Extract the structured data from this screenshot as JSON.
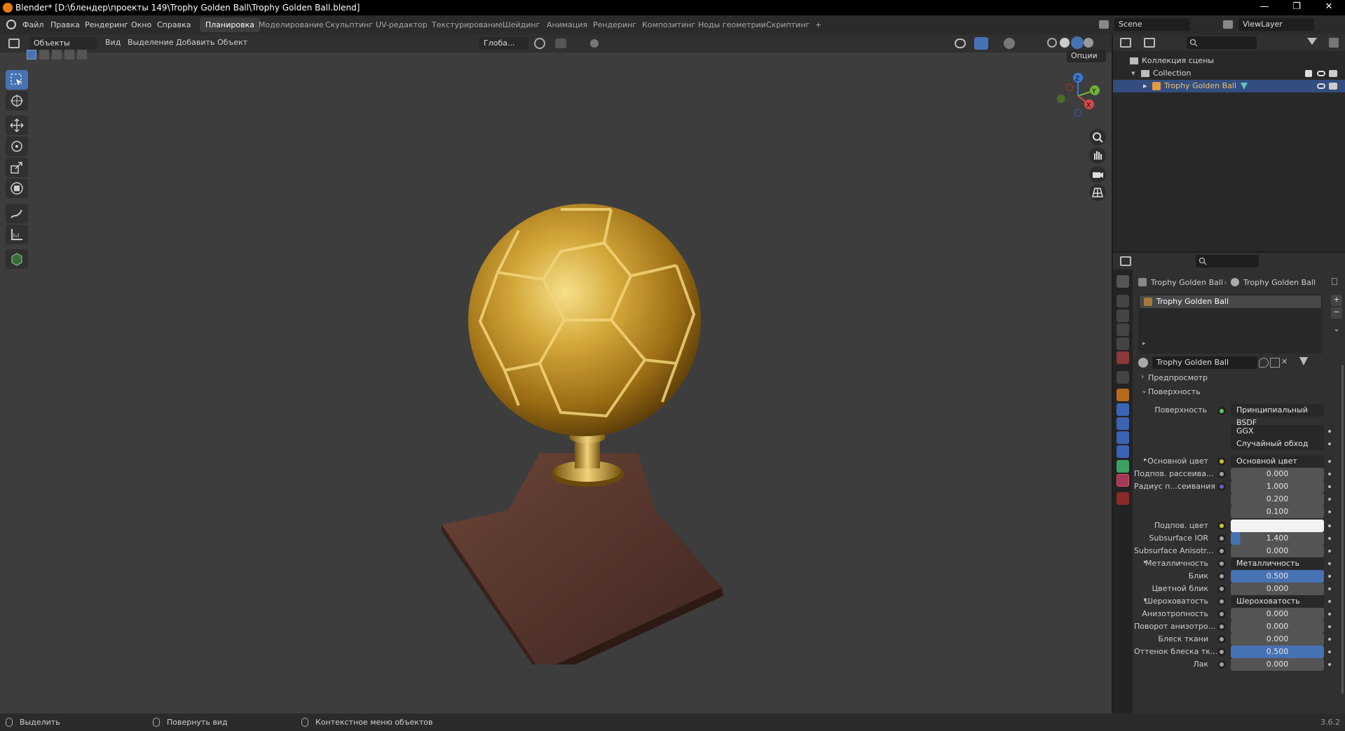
{
  "window": {
    "title": "Blender* [D:\\блендер\\проекты 149\\Trophy Golden Ball\\Trophy Golden Ball.blend]",
    "minimize": "—",
    "maximize": "❐",
    "close": "✕"
  },
  "menu": [
    "Файл",
    "Правка",
    "Рендеринг",
    "Окно",
    "Справка"
  ],
  "workspaces": [
    "Планировка",
    "Моделирование",
    "Скульптинг",
    "UV-редактор",
    "Текстурирование",
    "Шейдинг",
    "Анимация",
    "Рендеринг",
    "Композитинг",
    "Ноды геометрии",
    "Скриптинг",
    "+"
  ],
  "active_workspace": "Планировка",
  "scene": {
    "name": "Scene",
    "view_layer": "ViewLayer"
  },
  "viewport": {
    "mode": "Объекты",
    "menus": [
      "Вид",
      "Выделение",
      "Добавить",
      "Объект"
    ],
    "transform_orientation": "Глоба...",
    "options": "Опции",
    "gizmo": {
      "x": "X",
      "y": "Y",
      "z": "Z"
    }
  },
  "outliner": {
    "root": "Коллекция сцены",
    "collection": "Collection",
    "object": "Trophy Golden Ball"
  },
  "properties": {
    "breadcrumb_object": "Trophy Golden Ball",
    "breadcrumb_material": "Trophy Golden Ball",
    "slot": "Trophy Golden Ball",
    "material_name": "Trophy Golden Ball",
    "sections": {
      "preview": "Предпросмотр",
      "surface": "Поверхность"
    },
    "surface_label": "Поверхность",
    "surface_value": "Принципиальный BSDF",
    "distribution": "GGX",
    "subsurface_method": "Случайный обход",
    "rows": [
      {
        "label": "Основной цвет",
        "value": "Основной цвет",
        "type": "link",
        "sock": "yellow",
        "expand": true
      },
      {
        "label": "Подпов. рассеива...",
        "value": "0.000",
        "type": "num",
        "sock": "gray"
      },
      {
        "label": "Радиус п...сеивания",
        "value": "1.000",
        "type": "num",
        "sock": "blue"
      },
      {
        "label": "",
        "value": "0.200",
        "type": "num",
        "sock": "none"
      },
      {
        "label": "",
        "value": "0.100",
        "type": "num",
        "sock": "none"
      },
      {
        "label": "Подпов. цвет",
        "value": "",
        "type": "color",
        "sock": "yellow"
      },
      {
        "label": "Subsurface IOR",
        "value": "1.400",
        "type": "num",
        "sock": "gray"
      },
      {
        "label": "Subsurface Anisotr...",
        "value": "0.000",
        "type": "num",
        "sock": "gray"
      },
      {
        "label": "Металличность",
        "value": "Металличность",
        "type": "link",
        "sock": "gray",
        "expand": true
      },
      {
        "label": "Блик",
        "value": "0.500",
        "type": "bar",
        "sock": "gray"
      },
      {
        "label": "Цветной блик",
        "value": "0.000",
        "type": "num",
        "sock": "gray"
      },
      {
        "label": "Шероховатость",
        "value": "Шероховатость",
        "type": "link",
        "sock": "gray",
        "expand": true
      },
      {
        "label": "Анизотропность",
        "value": "0.000",
        "type": "num",
        "sock": "gray"
      },
      {
        "label": "Поворот анизотро...",
        "value": "0.000",
        "type": "num",
        "sock": "gray"
      },
      {
        "label": "Блеск ткани",
        "value": "0.000",
        "type": "num",
        "sock": "gray"
      },
      {
        "label": "Оттенок блеска тк...",
        "value": "0.500",
        "type": "bar",
        "sock": "gray"
      },
      {
        "label": "Лак",
        "value": "0.000",
        "type": "num",
        "sock": "gray"
      }
    ]
  },
  "statusbar": {
    "select": "Выделить",
    "rotate": "Повернуть вид",
    "context": "Контекстное меню объектов",
    "version": "3.6.2"
  }
}
